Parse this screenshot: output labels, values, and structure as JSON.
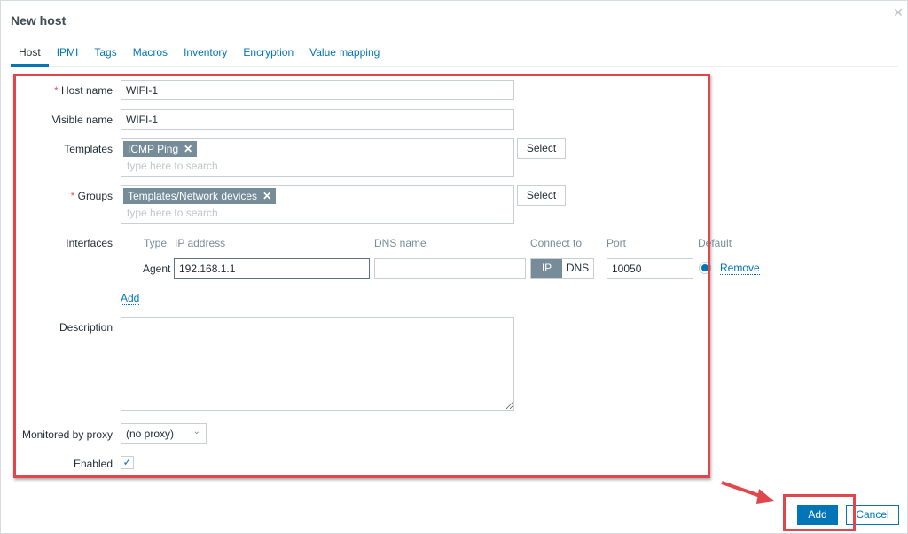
{
  "dialog": {
    "title": "New host",
    "close_icon": "close-icon"
  },
  "tabs": [
    {
      "label": "Host",
      "active": true
    },
    {
      "label": "IPMI"
    },
    {
      "label": "Tags"
    },
    {
      "label": "Macros"
    },
    {
      "label": "Inventory"
    },
    {
      "label": "Encryption"
    },
    {
      "label": "Value mapping"
    }
  ],
  "form": {
    "host_name": {
      "required_mark": "*",
      "label": "Host name",
      "value": "WIFI-1"
    },
    "visible_name": {
      "label": "Visible name",
      "value": "WIFI-1"
    },
    "templates": {
      "label": "Templates",
      "chips": [
        "ICMP Ping"
      ],
      "placeholder": "type here to search",
      "select_label": "Select"
    },
    "groups": {
      "required_mark": "*",
      "label": "Groups",
      "chips": [
        "Templates/Network devices"
      ],
      "placeholder": "type here to search",
      "select_label": "Select"
    },
    "interfaces": {
      "label": "Interfaces",
      "headers": {
        "type": "Type",
        "ip": "IP address",
        "dns": "DNS name",
        "connect": "Connect to",
        "port": "Port",
        "default": "Default"
      },
      "rows": [
        {
          "type": "Agent",
          "ip": "192.168.1.1",
          "dns": "",
          "connect_options": [
            "IP",
            "DNS"
          ],
          "connect_selected": "IP",
          "port": "10050",
          "default": true,
          "remove_label": "Remove"
        }
      ],
      "add_label": "Add"
    },
    "description": {
      "label": "Description",
      "value": ""
    },
    "proxy": {
      "label": "Monitored by proxy",
      "value": "(no proxy)"
    },
    "enabled": {
      "label": "Enabled",
      "checked": true
    }
  },
  "footer": {
    "add_label": "Add",
    "cancel_label": "Cancel"
  },
  "colors": {
    "accent": "#0275b8",
    "highlight": "#e0474c",
    "chip": "#768d99"
  }
}
